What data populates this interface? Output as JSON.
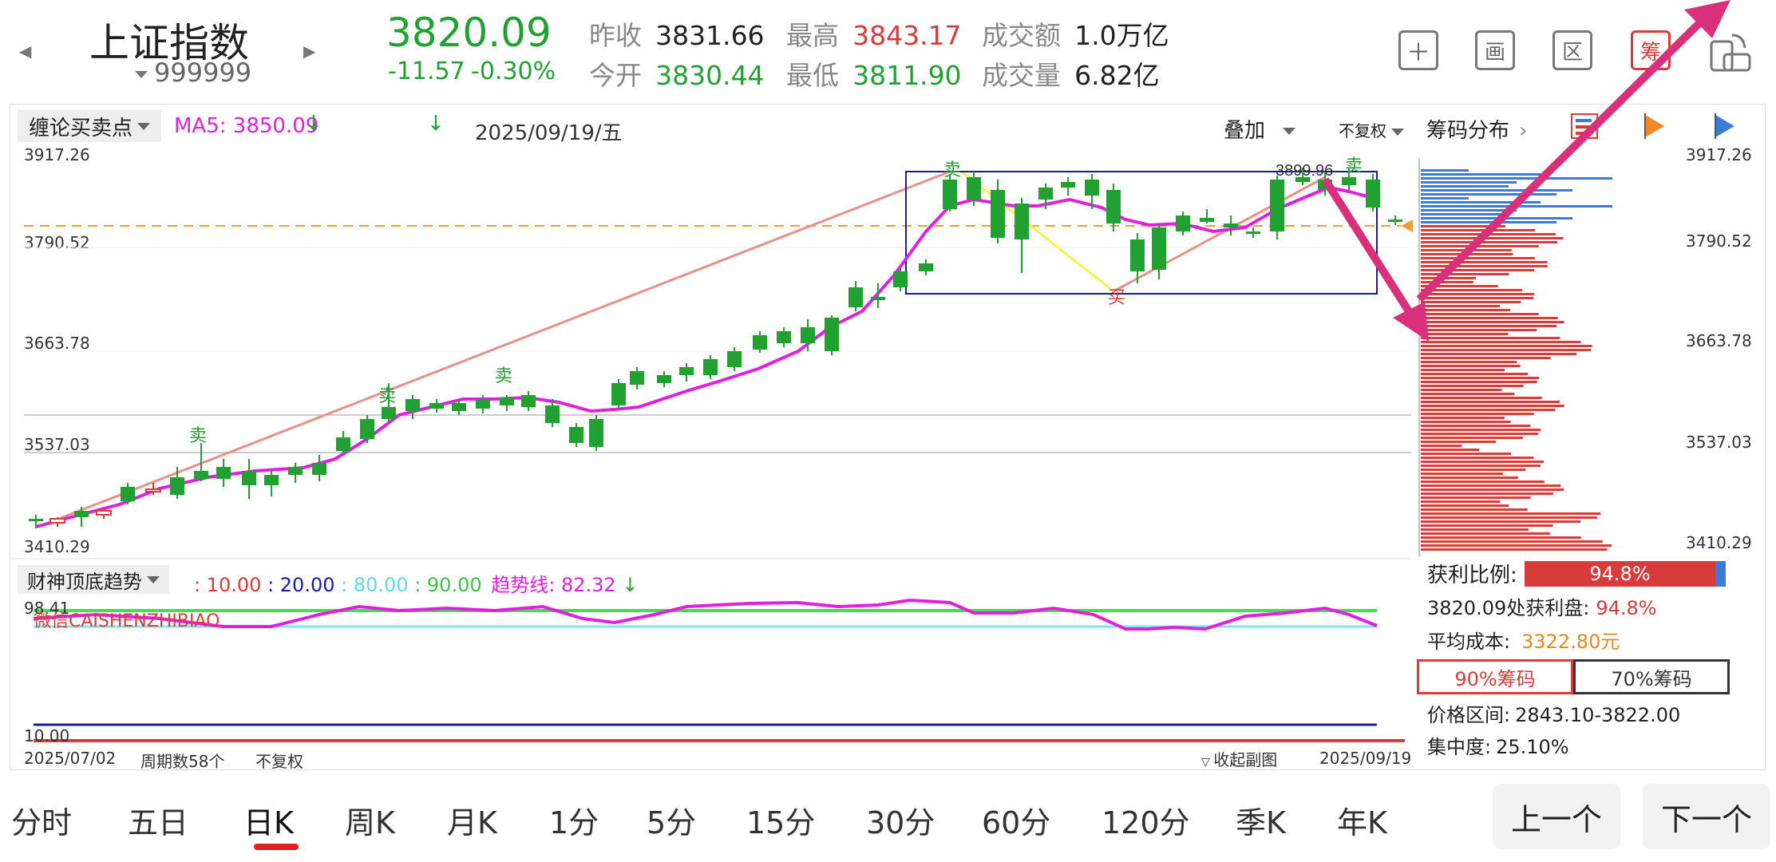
{
  "header": {
    "title": "上证指数",
    "code": "999999",
    "price": "3820.09",
    "change": "-11.57",
    "change_pct": "-0.30%",
    "stats": [
      {
        "label": "昨收",
        "value": "3831.66",
        "color": "#222222"
      },
      {
        "label": "今开",
        "value": "3830.44",
        "color": "#21a131"
      },
      {
        "label": "最高",
        "value": "3843.17",
        "color": "#d93a3a"
      },
      {
        "label": "最低",
        "value": "3811.90",
        "color": "#21a131"
      },
      {
        "label": "成交额",
        "value": "1.0万亿",
        "color": "#222222"
      },
      {
        "label": "成交量",
        "value": "6.82亿",
        "color": "#222222"
      }
    ],
    "icons": {
      "add": "＋",
      "draw": "画",
      "zone": "区",
      "chips": "筹"
    }
  },
  "toolbar": {
    "indicator": "缠论买卖点",
    "ma5": "MA5: 3850.09",
    "date": "2025/09/19/五",
    "overlay": "叠加",
    "adjust": "不复权",
    "chips": "筹码分布"
  },
  "price_axis": [
    "3917.26",
    "3790.52",
    "3663.78",
    "3537.03",
    "3410.29"
  ],
  "annotations": {
    "sell": "卖",
    "buy": "买",
    "peak_value": "3899.96"
  },
  "sub_indicator": {
    "name": "财神顶底趋势",
    "v1": ": 10.00",
    "v2": ": 20.00",
    "v3": ": 80.00",
    "v4": ": 90.00",
    "trend_label": "趋势线: 82.32",
    "top_value": "98.41",
    "bottom_value": "10.00",
    "watermark": "微信CAISHENZHIBIAO"
  },
  "footer": {
    "start_date": "2025/07/02",
    "period_count": "周期数58个",
    "adjust": "不复权",
    "collapse": "收起副图",
    "end_date": "2025/09/19"
  },
  "chips_panel": {
    "profit_ratio_label": "获利比例:",
    "profit_ratio": "94.8%",
    "profit_at_label": "3820.09处获利盘:",
    "profit_at": "94.8%",
    "avg_cost_label": "平均成本:",
    "avg_cost": "3322.80元",
    "tab90": "90%筹码",
    "tab70": "70%筹码",
    "range_label": "价格区间:",
    "range": "2843.10-3822.00",
    "concentration_label": "集中度:",
    "concentration": "25.10%"
  },
  "tabs": [
    "分时",
    "五日",
    "日K",
    "周K",
    "月K",
    "1分",
    "5分",
    "15分",
    "30分",
    "60分",
    "120分",
    "季K",
    "年K"
  ],
  "active_tab": "日K",
  "nav": {
    "prev": "上一个",
    "next": "下一个"
  },
  "colors": {
    "up": "#d93a3a",
    "down": "#21a131",
    "ma": "#e020e0",
    "box": "#1a1aa0",
    "arrow": "#d8307a",
    "chip_profit": "#d93a3a",
    "chip_loss": "#3a7ad8"
  }
}
